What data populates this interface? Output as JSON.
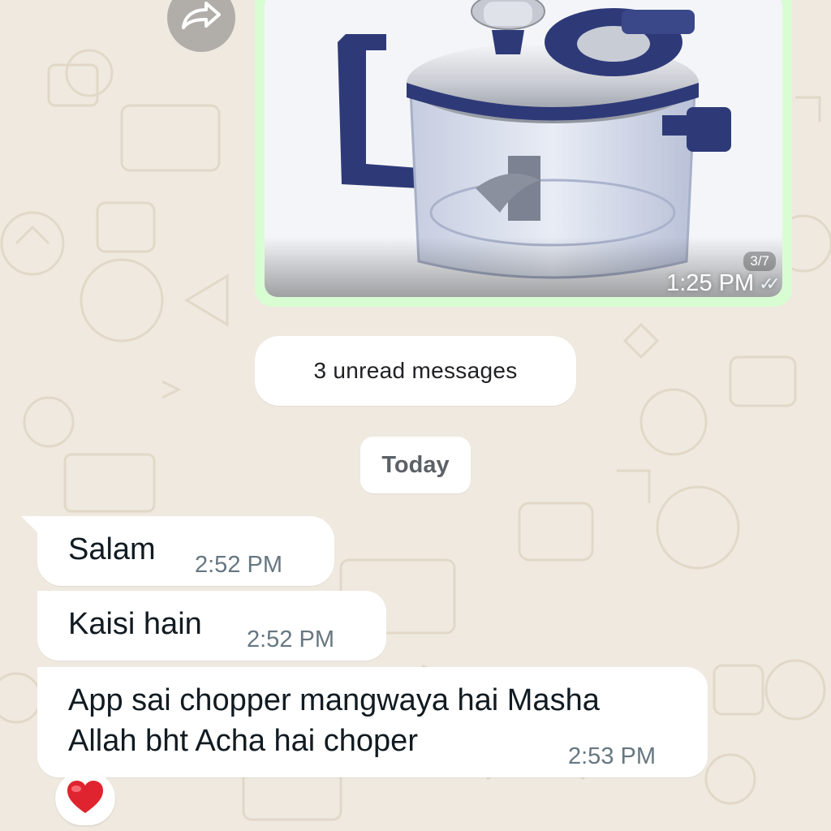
{
  "chat": {
    "outgoing_image": {
      "time": "1:25 PM",
      "counter": "3/7",
      "ticks_icon": "double-check-icon",
      "bubble_color": "#d9fdd3"
    },
    "forward_icon": "forward-icon",
    "unread_divider": "3 unread messages",
    "date_divider": "Today",
    "incoming_messages": [
      {
        "text": "Salam",
        "time": "2:52 PM"
      },
      {
        "text": "Kaisi hain",
        "time": "2:52 PM"
      },
      {
        "text_line1": "App sai chopper mangwaya hai Masha",
        "text_line2": "Allah bht Acha hai choper",
        "time": "2:53 PM"
      }
    ],
    "reaction": {
      "emoji": "heart-icon",
      "color": "#e0242f"
    },
    "wallpaper_color": "#efe9df"
  }
}
